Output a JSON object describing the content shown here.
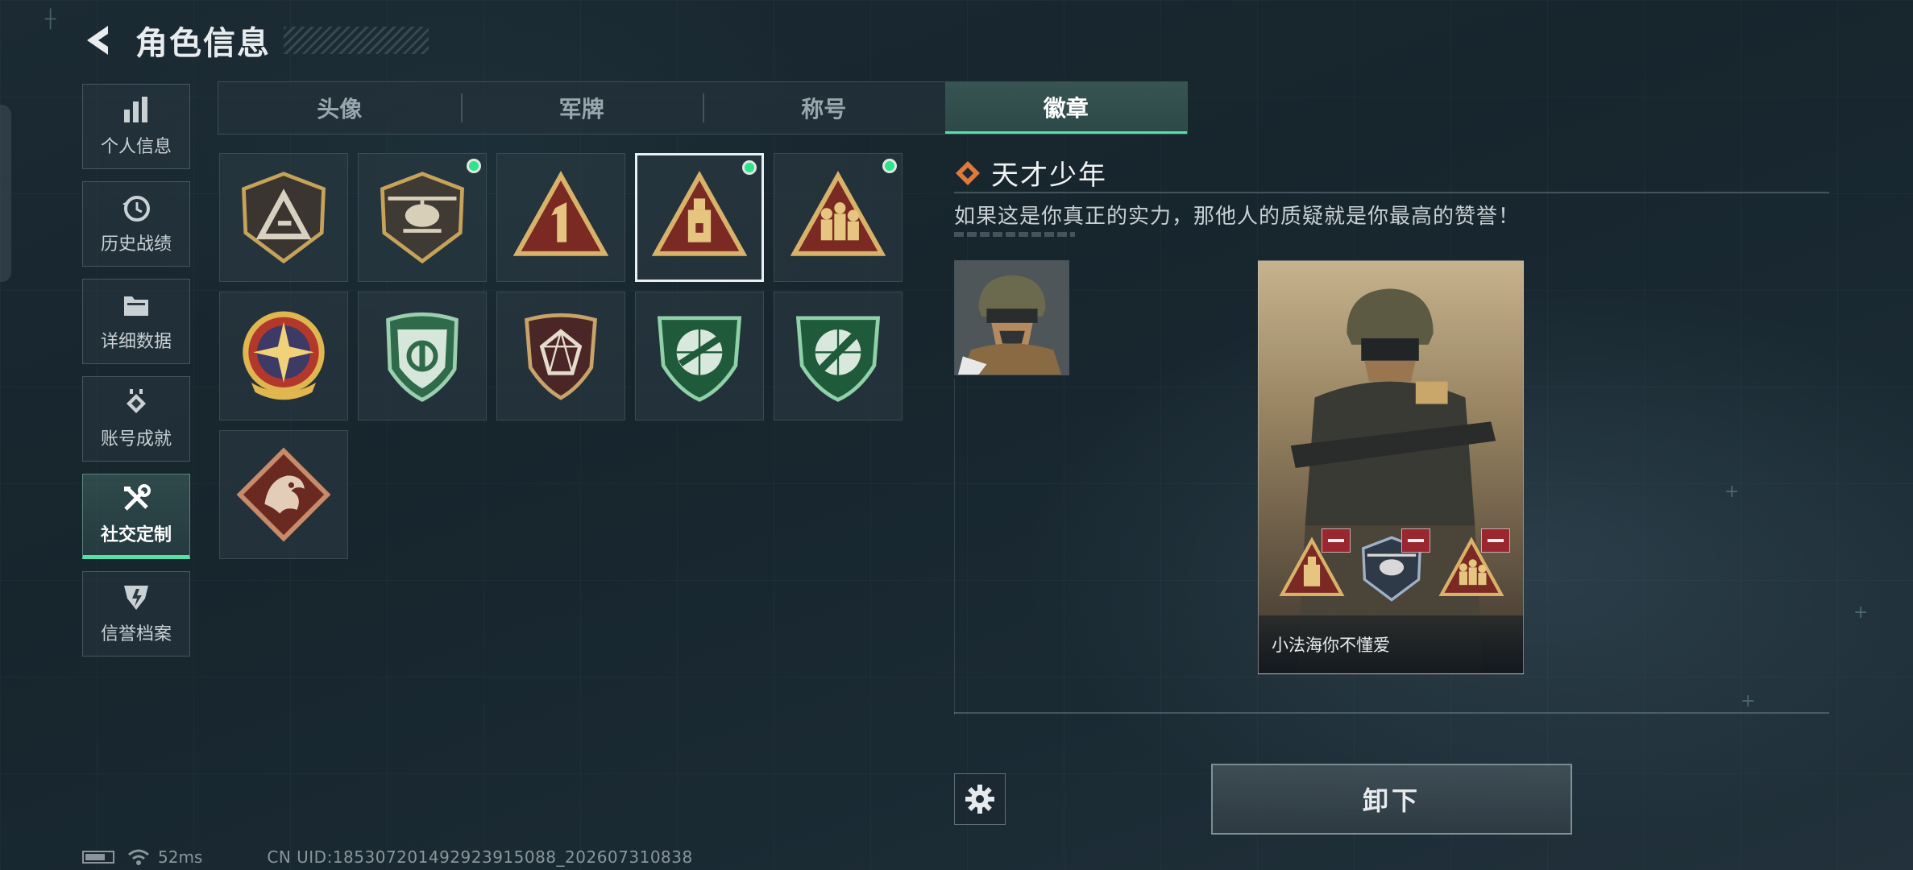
{
  "header": {
    "title": "角色信息"
  },
  "sidebar": {
    "items": [
      {
        "label": "个人信息",
        "icon": "bar-chart-icon"
      },
      {
        "label": "历史战绩",
        "icon": "history-icon"
      },
      {
        "label": "详细数据",
        "icon": "folder-icon"
      },
      {
        "label": "账号成就",
        "icon": "achievement-icon"
      },
      {
        "label": "社交定制",
        "icon": "tools-icon",
        "active": true
      },
      {
        "label": "信誉档案",
        "icon": "shield-icon"
      }
    ]
  },
  "tabs": [
    {
      "label": "头像"
    },
    {
      "label": "军牌"
    },
    {
      "label": "称号"
    },
    {
      "label": "徽章",
      "active": true
    }
  ],
  "badges": [
    {
      "name": "triangle-logo-badge",
      "equipped": false
    },
    {
      "name": "helicopter-badge",
      "equipped": true
    },
    {
      "name": "number-one-badge",
      "equipped": false
    },
    {
      "name": "tower-badge",
      "equipped": true,
      "selected": true
    },
    {
      "name": "soldiers-badge",
      "equipped": true
    },
    {
      "name": "star-medal-badge",
      "equipped": false
    },
    {
      "name": "green-shield-badge",
      "equipped": false
    },
    {
      "name": "gem-shield-badge",
      "equipped": false
    },
    {
      "name": "rifle-crest-badge",
      "equipped": false
    },
    {
      "name": "knife-crest-badge",
      "equipped": false
    },
    {
      "name": "dragon-badge",
      "equipped": false
    }
  ],
  "detail": {
    "badge_name": "天才少年",
    "description": "如果这是你真正的实力，那他人的质疑就是你最高的赞誉！",
    "card_player_name": "小法海你不懂爱",
    "unequip_label": "卸下"
  },
  "status": {
    "ping": "52ms",
    "uid": "CN UID:18530720149292391​5088_202607310838"
  },
  "colors": {
    "accent_green": "#55e0a8",
    "equipped_dot": "#2fe38a",
    "remove_red": "#9a2630"
  }
}
